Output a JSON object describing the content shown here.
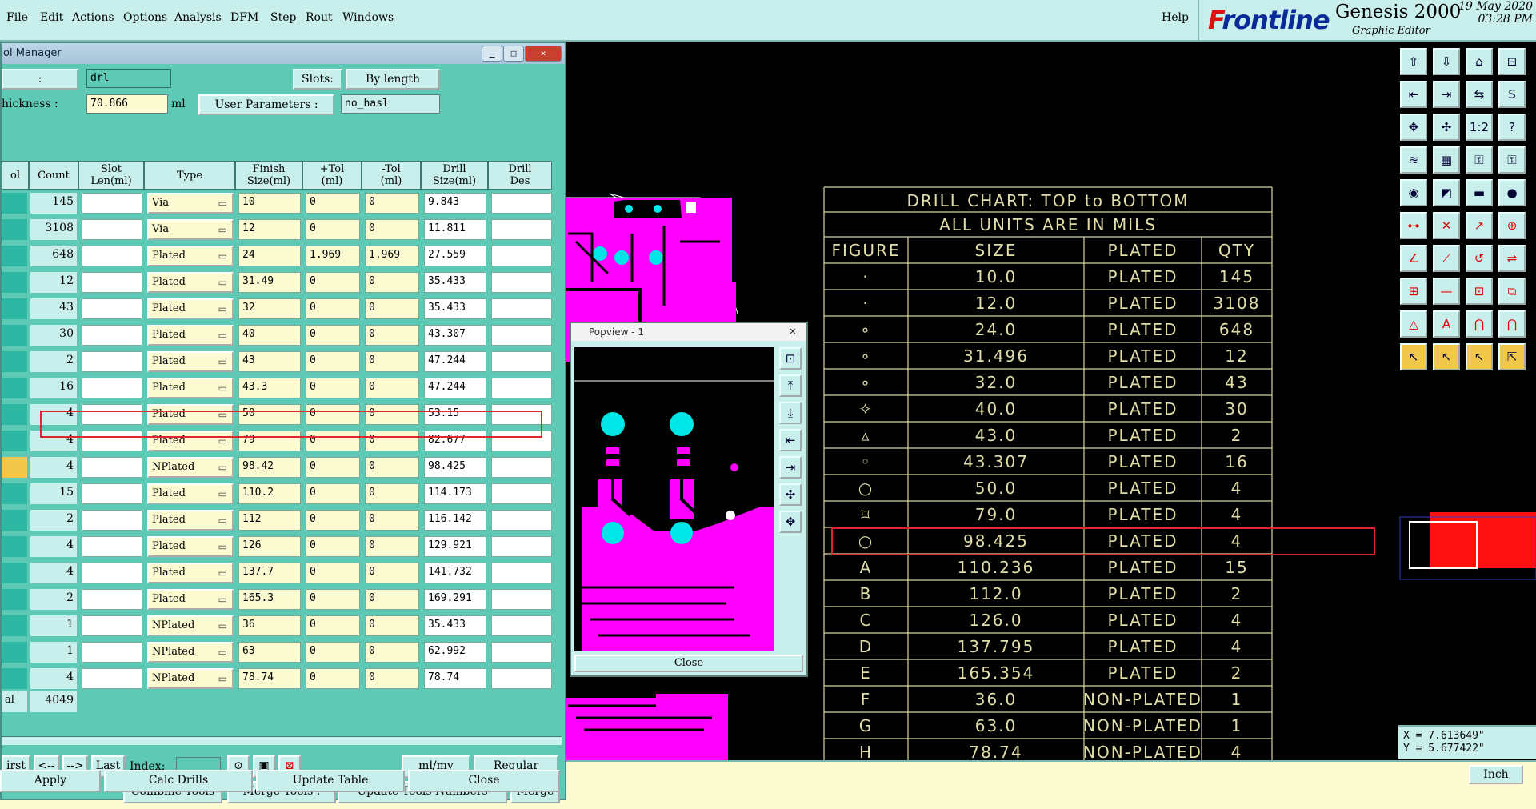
{
  "menu": [
    "File",
    "Edit",
    "Actions",
    "Options",
    "Analysis",
    "DFM",
    "Step",
    "Rout",
    "Windows"
  ],
  "help_label": "Help",
  "brand": {
    "logo_prefix": "F",
    "logo_rest": "rontline",
    "product": "Genesis 2000",
    "subtitle": "Graphic Editor",
    "date": "19 May 2020",
    "time": "03:28 PM"
  },
  "tool_manager": {
    "title": "ol Manager",
    "name_label": ":",
    "name_value": "drl",
    "slots_label": "Slots:",
    "slots_value": "By length",
    "thickness_label": "hickness :",
    "thickness_value": "70.866",
    "thickness_unit": "ml",
    "user_params_label": "User Parameters :",
    "user_params_value": "no_hasl",
    "headers": {
      "tool": "ol",
      "count": "Count",
      "slot1": "Slot",
      "slot2": "Len(ml)",
      "type": "Type",
      "finish1": "Finish",
      "finish2": "Size(ml)",
      "ptol1": "+Tol",
      "ptol2": "(ml)",
      "mtol1": "-Tol",
      "mtol2": "(ml)",
      "drill1": "Drill",
      "drill2": "Size(ml)",
      "des1": "Drill",
      "des2": "Des"
    },
    "rows": [
      {
        "count": "145",
        "type": "Via",
        "finish": "10",
        "ptol": "0",
        "mtol": "0",
        "drill": "9.843"
      },
      {
        "count": "3108",
        "type": "Via",
        "finish": "12",
        "ptol": "0",
        "mtol": "0",
        "drill": "11.811"
      },
      {
        "count": "648",
        "type": "Plated",
        "finish": "24",
        "ptol": "1.969",
        "mtol": "1.969",
        "drill": "27.559"
      },
      {
        "count": "12",
        "type": "Plated",
        "finish": "31.49",
        "ptol": "0",
        "mtol": "0",
        "drill": "35.433"
      },
      {
        "count": "43",
        "type": "Plated",
        "finish": "32",
        "ptol": "0",
        "mtol": "0",
        "drill": "35.433"
      },
      {
        "count": "30",
        "type": "Plated",
        "finish": "40",
        "ptol": "0",
        "mtol": "0",
        "drill": "43.307"
      },
      {
        "count": "2",
        "type": "Plated",
        "finish": "43",
        "ptol": "0",
        "mtol": "0",
        "drill": "47.244"
      },
      {
        "count": "16",
        "type": "Plated",
        "finish": "43.3",
        "ptol": "0",
        "mtol": "0",
        "drill": "47.244"
      },
      {
        "count": "4",
        "type": "Plated",
        "finish": "50",
        "ptol": "0",
        "mtol": "0",
        "drill": "53.15"
      },
      {
        "count": "4",
        "type": "Plated",
        "finish": "79",
        "ptol": "0",
        "mtol": "0",
        "drill": "82.677"
      },
      {
        "count": "4",
        "type": "NPlated",
        "finish": "98.42",
        "ptol": "0",
        "mtol": "0",
        "drill": "98.425"
      },
      {
        "count": "15",
        "type": "Plated",
        "finish": "110.2",
        "ptol": "0",
        "mtol": "0",
        "drill": "114.173"
      },
      {
        "count": "2",
        "type": "Plated",
        "finish": "112",
        "ptol": "0",
        "mtol": "0",
        "drill": "116.142"
      },
      {
        "count": "4",
        "type": "Plated",
        "finish": "126",
        "ptol": "0",
        "mtol": "0",
        "drill": "129.921"
      },
      {
        "count": "4",
        "type": "Plated",
        "finish": "137.7",
        "ptol": "0",
        "mtol": "0",
        "drill": "141.732"
      },
      {
        "count": "2",
        "type": "Plated",
        "finish": "165.3",
        "ptol": "0",
        "mtol": "0",
        "drill": "169.291"
      },
      {
        "count": "1",
        "type": "NPlated",
        "finish": "36",
        "ptol": "0",
        "mtol": "0",
        "drill": "35.433"
      },
      {
        "count": "1",
        "type": "NPlated",
        "finish": "63",
        "ptol": "0",
        "mtol": "0",
        "drill": "62.992"
      },
      {
        "count": "4",
        "type": "NPlated",
        "finish": "78.74",
        "ptol": "0",
        "mtol": "0",
        "drill": "78.74"
      }
    ],
    "total_label": "al",
    "total_count": "4049",
    "nav": {
      "first": "irst",
      "prev": "<--",
      "next": "-->",
      "last": "Last",
      "index_label": "Index:",
      "units": "ml/my",
      "mode": "Regular"
    },
    "actions": {
      "combine": "Combine Tools",
      "merge_tools": "Merge Tools :",
      "update_numbers": "Update Tools Numbers",
      "merge": "Merge"
    },
    "bottom": {
      "apply": "Apply",
      "calc": "Calc Drills",
      "update_table": "Update Table",
      "close": "Close"
    }
  },
  "popview": {
    "title": "Popview - 1",
    "close": "Close"
  },
  "drill_chart": {
    "title1": "DRILL CHART: TOP to BOTTOM",
    "title2": "ALL UNITS ARE IN MILS",
    "headers": [
      "FIGURE",
      "SIZE",
      "PLATED",
      "QTY"
    ],
    "rows": [
      {
        "fig": "·",
        "size": "10.0",
        "plated": "PLATED",
        "qty": "145"
      },
      {
        "fig": "·",
        "size": "12.0",
        "plated": "PLATED",
        "qty": "3108"
      },
      {
        "fig": "∘",
        "size": "24.0",
        "plated": "PLATED",
        "qty": "648"
      },
      {
        "fig": "∘",
        "size": "31.496",
        "plated": "PLATED",
        "qty": "12"
      },
      {
        "fig": "∘",
        "size": "32.0",
        "plated": "PLATED",
        "qty": "43"
      },
      {
        "fig": "✧",
        "size": "40.0",
        "plated": "PLATED",
        "qty": "30"
      },
      {
        "fig": "▵",
        "size": "43.0",
        "plated": "PLATED",
        "qty": "2"
      },
      {
        "fig": "◦",
        "size": "43.307",
        "plated": "PLATED",
        "qty": "16"
      },
      {
        "fig": "○",
        "size": "50.0",
        "plated": "PLATED",
        "qty": "4"
      },
      {
        "fig": "⌑",
        "size": "79.0",
        "plated": "PLATED",
        "qty": "4"
      },
      {
        "fig": "○",
        "size": "98.425",
        "plated": "PLATED",
        "qty": "4"
      },
      {
        "fig": "A",
        "size": "110.236",
        "plated": "PLATED",
        "qty": "15"
      },
      {
        "fig": "B",
        "size": "112.0",
        "plated": "PLATED",
        "qty": "2"
      },
      {
        "fig": "C",
        "size": "126.0",
        "plated": "PLATED",
        "qty": "4"
      },
      {
        "fig": "D",
        "size": "137.795",
        "plated": "PLATED",
        "qty": "4"
      },
      {
        "fig": "E",
        "size": "165.354",
        "plated": "PLATED",
        "qty": "2"
      },
      {
        "fig": "F",
        "size": "36.0",
        "plated": "NON-PLATED",
        "qty": "1"
      },
      {
        "fig": "G",
        "size": "63.0",
        "plated": "NON-PLATED",
        "qty": "1"
      },
      {
        "fig": "H",
        "size": "78.74",
        "plated": "NON-PLATED",
        "qty": "4"
      }
    ]
  },
  "coords": {
    "x": "X = 7.613649\"",
    "y": "Y = 5.677422\""
  },
  "units_button": "Inch",
  "colors": {
    "panel": "#5ecab5",
    "button": "#c9efec",
    "field": "#fbfad0",
    "highlight": "#e0262e",
    "board": "#ff00ff",
    "pad": "#00e5e5",
    "chart": "#d8d59c"
  }
}
